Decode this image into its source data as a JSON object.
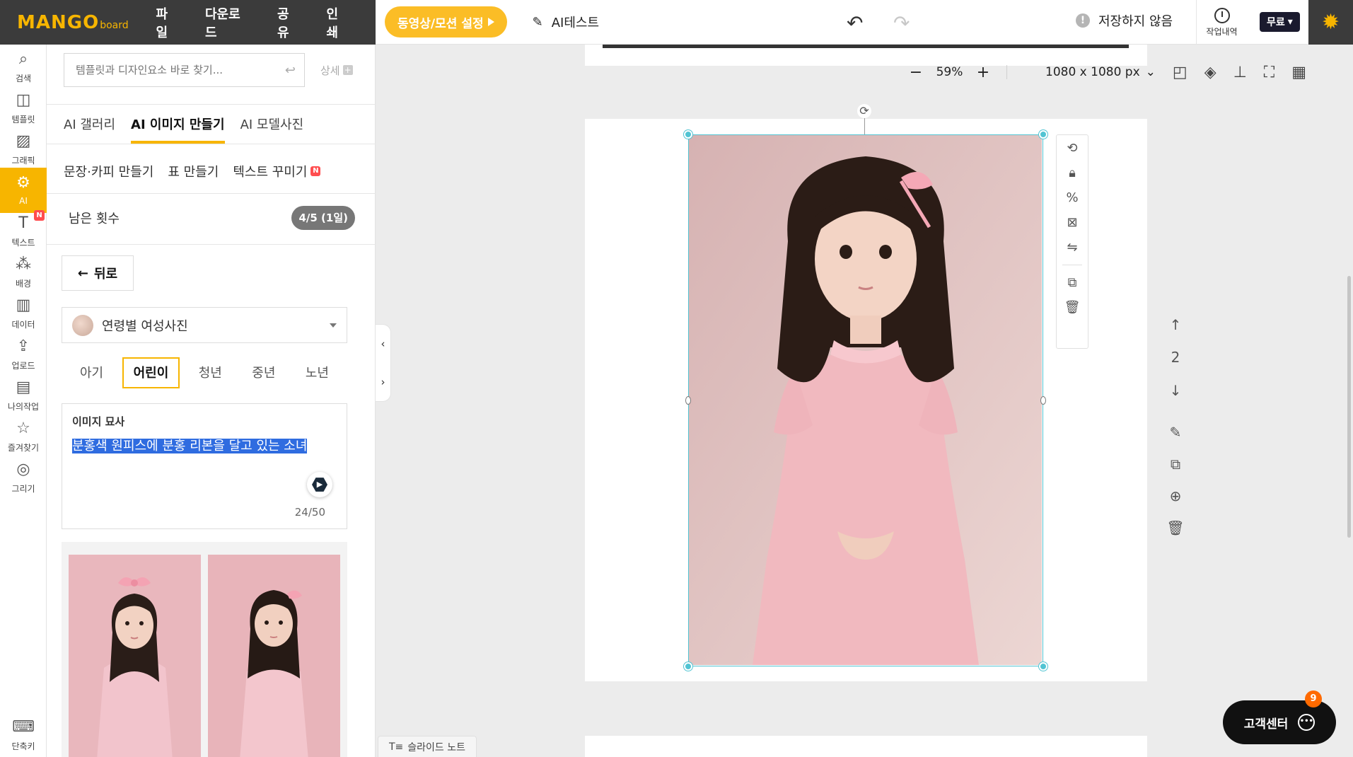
{
  "app": {
    "logo_main": "MANGO",
    "logo_sub": "board",
    "menu": [
      "파일",
      "다운로드",
      "공유",
      "인쇄"
    ],
    "motion_button": "동영상/모션 설정",
    "doc_title": "AI테스트",
    "save_status": "저장하지 않음",
    "history_label": "작업내역",
    "plan_label": "무료",
    "accent_color": "#f7b500"
  },
  "rail": [
    {
      "label": "검색",
      "icon": "search-icon"
    },
    {
      "label": "템플릿",
      "icon": "template-icon"
    },
    {
      "label": "그래픽",
      "icon": "graphic-icon"
    },
    {
      "label": "AI",
      "icon": "ai-icon",
      "active": true
    },
    {
      "label": "텍스트",
      "icon": "text-icon",
      "badge": "N"
    },
    {
      "label": "배경",
      "icon": "background-icon"
    },
    {
      "label": "데이터",
      "icon": "chart-icon"
    },
    {
      "label": "업로드",
      "icon": "upload-icon"
    },
    {
      "label": "나의작업",
      "icon": "my-work-icon"
    },
    {
      "label": "즐겨찾기",
      "icon": "star-icon"
    },
    {
      "label": "그리기",
      "icon": "draw-icon"
    }
  ],
  "rail_bottom": {
    "label": "단축키",
    "icon": "keyboard-icon"
  },
  "panel": {
    "search_placeholder": "템플릿과 디자인요소 바로 찾기...",
    "detail_label": "상세",
    "tabs": [
      "AI 갤러리",
      "AI 이미지 만들기",
      "AI 모델사진"
    ],
    "active_tab": 1,
    "subtabs": [
      "문장·카피 만들기",
      "표 만들기",
      "텍스트 꾸미기"
    ],
    "subtab_badge": "N",
    "remaining_label": "남은 횟수",
    "remaining_value": "4/5 (1일)",
    "back_label": "뒤로",
    "category": "연령별 여성사진",
    "ages": [
      "아기",
      "어린이",
      "청년",
      "중년",
      "노년"
    ],
    "active_age": 1,
    "desc_label": "이미지 묘사",
    "desc_text": "분홍색 원피스에 분홍 리본을 달고 있는 소녀",
    "desc_count": "24/50"
  },
  "canvas": {
    "zoom": "59%",
    "size": "1080 x 1080 px",
    "page_number": "2",
    "slide_note": "슬라이드 노트",
    "support_label": "고객센터",
    "support_badge": "9"
  }
}
